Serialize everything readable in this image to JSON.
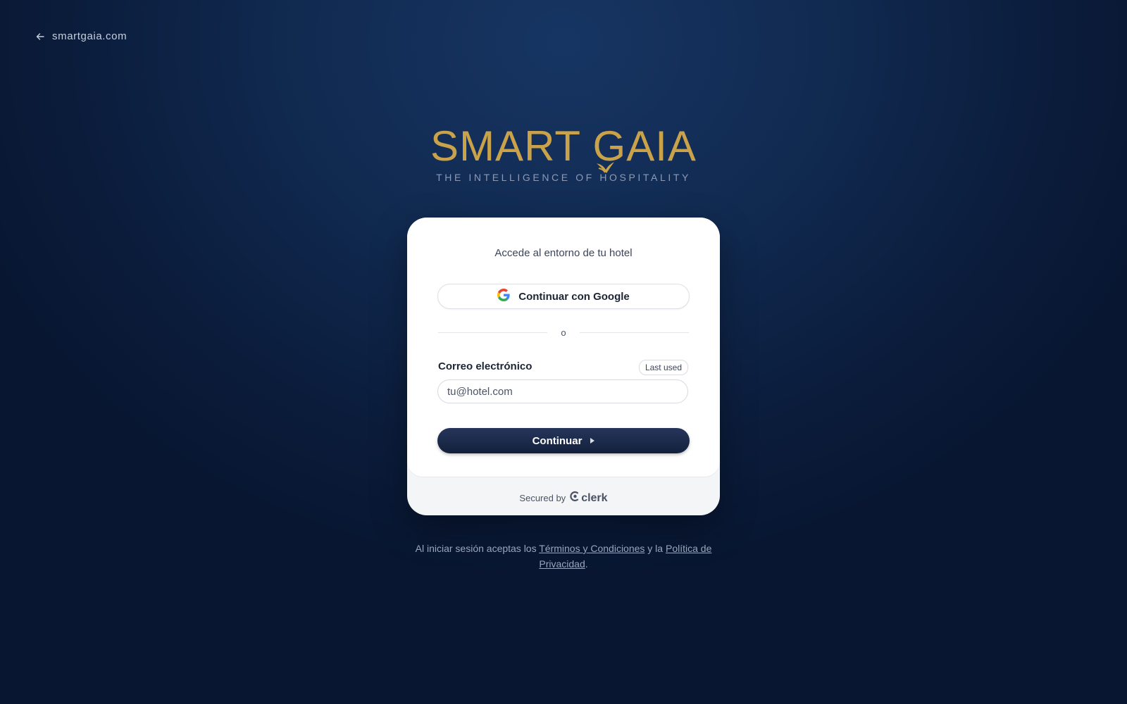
{
  "nav": {
    "back_label": "smartgaia.com",
    "back_icon": "arrow-left-icon"
  },
  "brand": {
    "wordmark": "SMART GAIA",
    "tagline": "THE INTELLIGENCE OF HOSPITALITY",
    "color": "#c9a24a"
  },
  "card": {
    "subtitle": "Accede al entorno de tu hotel",
    "google_button_label": "Continuar con Google",
    "divider_text": "o",
    "email_label": "Correo electrónico",
    "last_used_badge": "Last used",
    "email_placeholder": "tu@hotel.com",
    "email_value": "",
    "continue_label": "Continuar",
    "footer_secured_label": "Secured by",
    "footer_clerk_label": "clerk"
  },
  "legal": {
    "prefix": "Al iniciar sesión aceptas los ",
    "terms_link": "Términos y Condiciones",
    "middle": " y la ",
    "privacy_link": "Política de Privacidad",
    "suffix": "."
  },
  "colors": {
    "background": "#0f2a52",
    "primary_button": "#1b2a4a",
    "accent_gold": "#c9a24a"
  }
}
